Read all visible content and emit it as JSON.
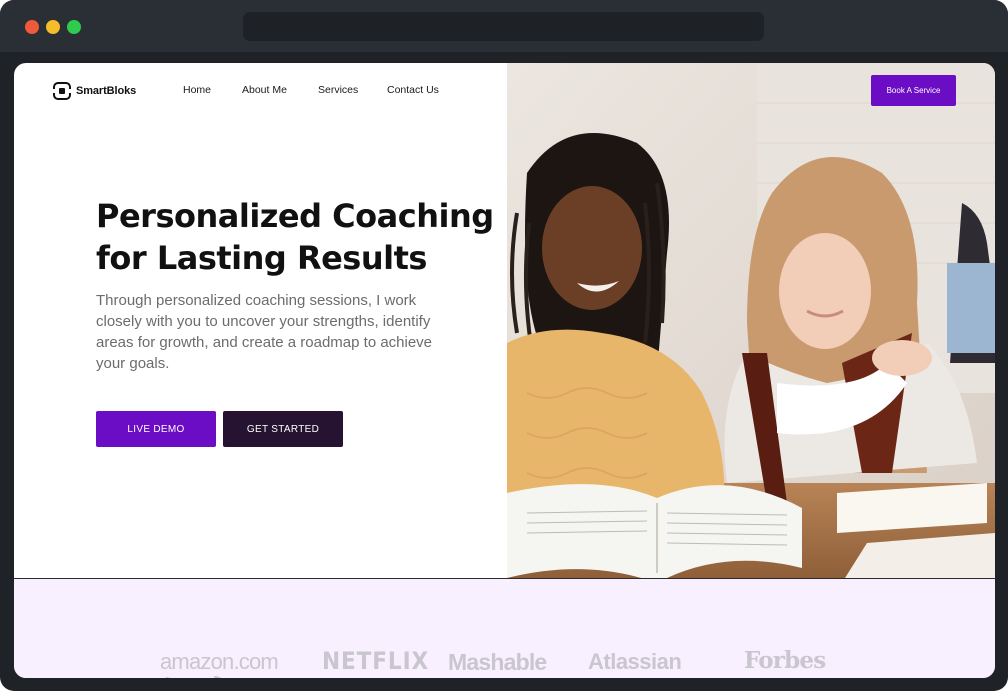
{
  "app": {
    "brand_name": "SmartBloks",
    "colors": {
      "accent": "#6a0dc4",
      "dark_button": "#261331",
      "brands_band": "#f8f0fe"
    }
  },
  "nav": {
    "items": [
      {
        "label": "Home"
      },
      {
        "label": "About Me"
      },
      {
        "label": "Services"
      },
      {
        "label": "Contact Us"
      }
    ],
    "cta_label": "Book A Service"
  },
  "hero": {
    "headline": "Personalized Coaching for Lasting Results",
    "subtext": "Through personalized coaching sessions, I work closely with you to uncover your strengths, identify areas for growth, and create a roadmap to achieve your goals.",
    "primary_button": "LIVE DEMO",
    "secondary_button": "GET STARTED",
    "image_icon": "two-women-reading-photo"
  },
  "brands": [
    {
      "label": "amazon.com"
    },
    {
      "label": "NETFLIX"
    },
    {
      "label": "Mashable"
    },
    {
      "label": "Atlassian"
    },
    {
      "label": "Forbes"
    }
  ]
}
